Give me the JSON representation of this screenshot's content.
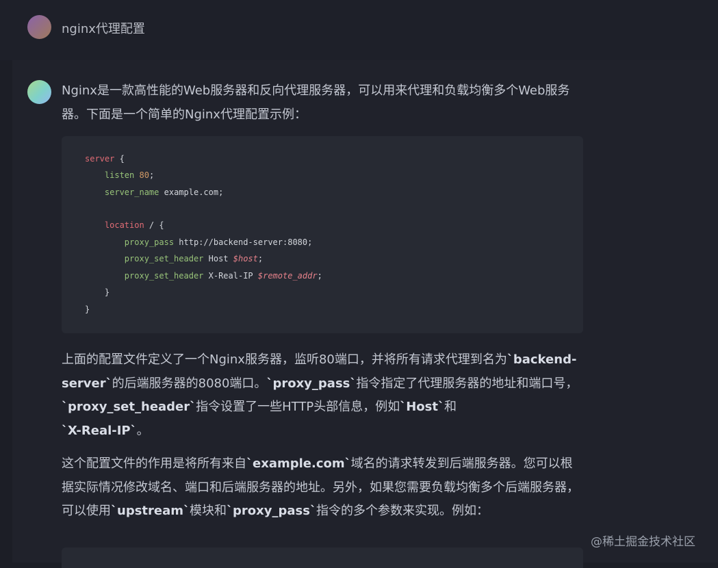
{
  "user_message": {
    "text": "nginx代理配置"
  },
  "assistant": {
    "intro": "Nginx是一款高性能的Web服务器和反向代理服务器，可以用来代理和负载均衡多个Web服务器。下面是一个简单的Nginx代理配置示例：",
    "code": {
      "l1_kw": "server",
      "l1_rest": " {",
      "l2_dir": "listen",
      "l2_num": "80",
      "l2_rest": ";",
      "l3_dir": "server_name",
      "l3_rest": " example.com;",
      "l5_kw": "location",
      "l5_rest": " / {",
      "l6_dir": "proxy_pass",
      "l6_rest": " http://backend-server:8080;",
      "l7_dir": "proxy_set_header",
      "l7_mid": " Host ",
      "l7_var": "$host",
      "l7_end": ";",
      "l8_dir": "proxy_set_header",
      "l8_mid": " X-Real-IP ",
      "l8_var": "$remote_addr",
      "l8_end": ";",
      "l9": "}",
      "l10": "}"
    },
    "p2": {
      "t1": "上面的配置文件定义了一个Nginx服务器，监听80端口，并将所有请求代理到名为",
      "b1": "`backend-server`",
      "t2": "的后端服务器的8080端口。",
      "b2": "`proxy_pass`",
      "t3": "指令指定了代理服务器的地址和端口号，",
      "b3": "`proxy_set_header`",
      "t4": "指令设置了一些HTTP头部信息，例如",
      "b4": "`Host`",
      "t5": "和",
      "b5": "`X-Real-IP`",
      "t6": "。"
    },
    "p3": {
      "t1": "这个配置文件的作用是将所有来自",
      "b1": "`example.com`",
      "t2": "域名的请求转发到后端服务器。您可以根据实际情况修改域名、端口和后端服务器的地址。另外，如果您需要负载均衡多个后端服务器，可以使用",
      "b2": "`upstream`",
      "t3": "模块和",
      "b3": "`proxy_pass`",
      "t4": "指令的多个参数来实现。例如："
    }
  },
  "watermark": "@稀土掘金技术社区",
  "colors": {
    "background": "#1c1e26",
    "code_bg": "#272a33",
    "keyword": "#e06c75",
    "directive": "#98c379",
    "number": "#d19a66"
  }
}
